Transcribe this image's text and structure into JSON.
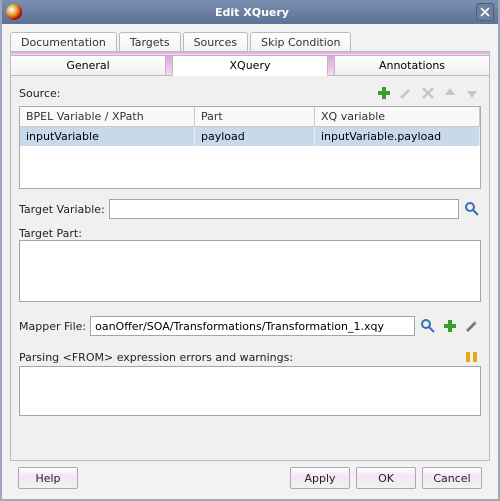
{
  "window": {
    "title": "Edit XQuery"
  },
  "tabsTop": {
    "documentation": "Documentation",
    "targets": "Targets",
    "sources": "Sources",
    "skip": "Skip Condition"
  },
  "tabsMain": {
    "general": "General",
    "xquery": "XQuery",
    "annotations": "Annotations"
  },
  "source": {
    "label": "Source:",
    "headers": {
      "bpel": "BPEL Variable / XPath",
      "part": "Part",
      "xq": "XQ variable"
    },
    "row": {
      "bpel": "inputVariable",
      "part": "payload",
      "xq": "inputVariable.payload"
    }
  },
  "targetVar": {
    "label": "Target Variable:",
    "value": ""
  },
  "targetPart": {
    "label": "Target Part:"
  },
  "mapper": {
    "label": "Mapper File:",
    "value": "oanOffer/SOA/Transformations/Transformation_1.xqy"
  },
  "parsing": {
    "label": "Parsing <FROM> expression errors and warnings:"
  },
  "buttons": {
    "help": "Help",
    "apply": "Apply",
    "ok": "OK",
    "cancel": "Cancel"
  }
}
